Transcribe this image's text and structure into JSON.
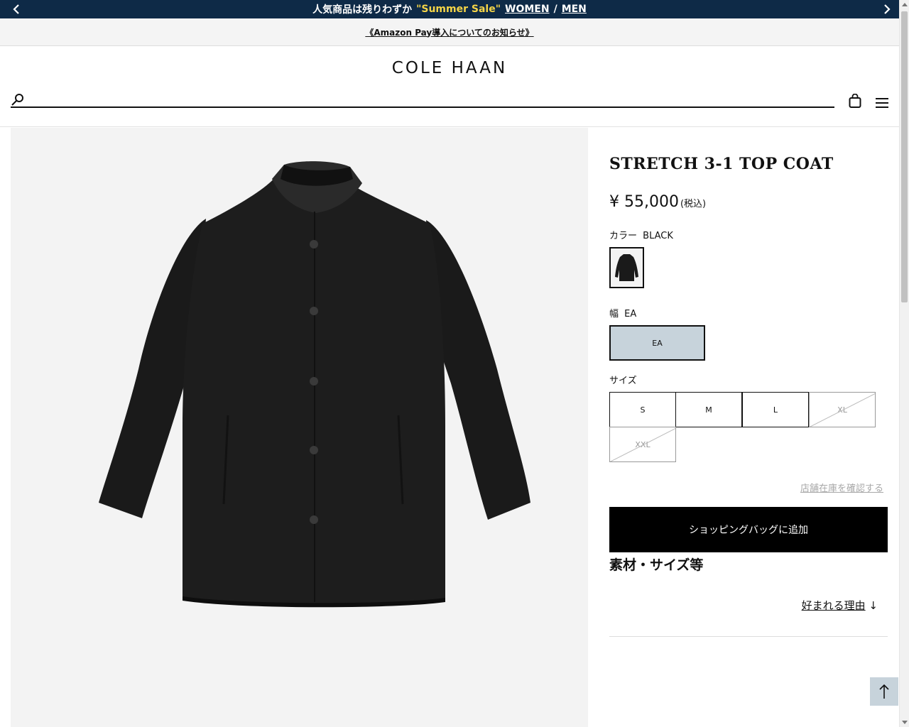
{
  "promo": {
    "text": "人気商品は残りわずか",
    "highlight": "\"Summer Sale\"",
    "women_link": "WOMEN",
    "separator": "/",
    "men_link": "MEN",
    "prev_icon": "chevron-left-icon",
    "next_icon": "chevron-right-icon",
    "background_color": "#0e2a47",
    "highlight_color": "#f5d547"
  },
  "notice": {
    "link_text": "《Amazon Pay導入についてのお知らせ》"
  },
  "header": {
    "logo": "COLE HAAN",
    "search_placeholder": "",
    "search_icon": "search-icon",
    "bag_icon": "shopping-bag-icon",
    "menu_icon": "hamburger-menu-icon"
  },
  "product": {
    "title": "STRETCH 3-1 TOP COAT",
    "price": "¥ 55,000",
    "tax_note": "(税込)",
    "color_label": "カラー",
    "color_value": "BLACK",
    "width_label": "幅",
    "width_value": "EA",
    "width_option": "EA",
    "size_label": "サイズ",
    "sizes": [
      {
        "label": "S",
        "available": true
      },
      {
        "label": "M",
        "available": true
      },
      {
        "label": "L",
        "available": true
      },
      {
        "label": "XL",
        "available": false
      },
      {
        "label": "XXL",
        "available": false
      }
    ],
    "store_stock_link": "店舗在庫を確認する",
    "add_to_bag": "ショッピングバッグに追加",
    "material_heading": "素材・サイズ等",
    "reason_link": "好まれる理由",
    "reason_arrow": "↓"
  },
  "colors": {
    "selected_option_bg": "#c7d3db",
    "button_black": "#000000",
    "gallery_bg": "#f3f3f3"
  }
}
